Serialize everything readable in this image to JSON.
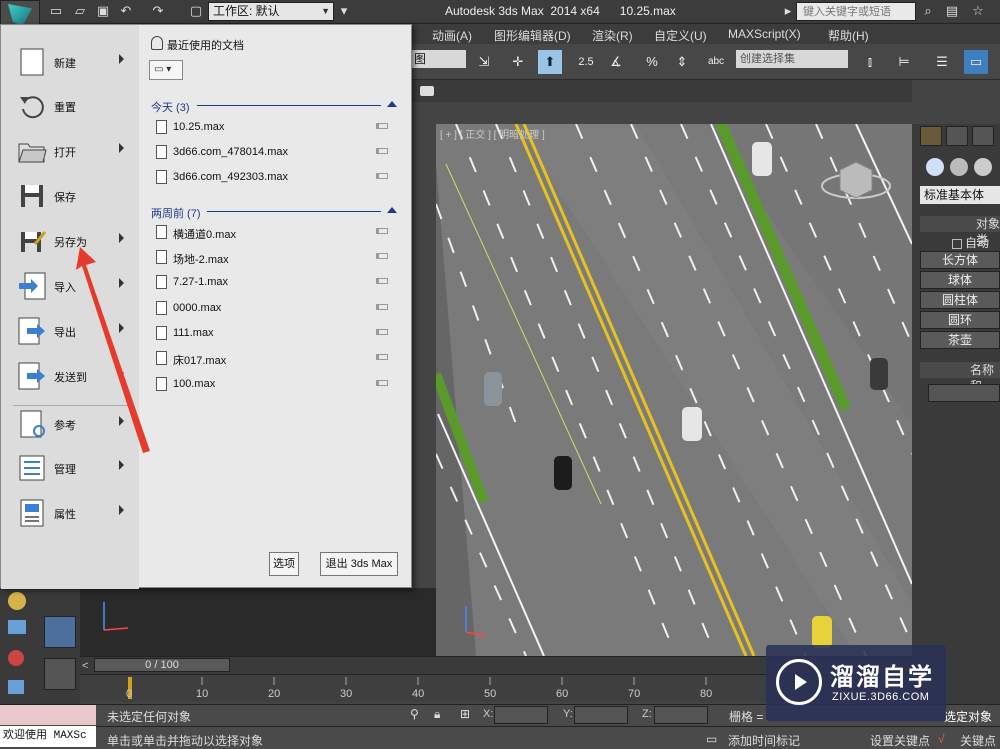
{
  "titlebar": {
    "workspace_label": "工作区: 默认",
    "app_title": "Autodesk 3ds Max  2014 x64      10.25.max",
    "search_placeholder": "键入关键字或短语"
  },
  "menubar": {
    "items": [
      "动画(A)",
      "图形编辑器(D)",
      "渲染(R)",
      "自定义(U)",
      "MAXScript(X)",
      "帮助(H)"
    ]
  },
  "toolbar": {
    "view_select": "图",
    "snap_value": "2.5",
    "selection_set_placeholder": "创建选择集"
  },
  "viewport": {
    "label": "[ + ] [ 正交 ] [ 明暗处理 ]"
  },
  "command_panel": {
    "dropdown": "标准基本体",
    "object_type_header": "对象类",
    "autogrid": "自动栅",
    "buttons": [
      "长方体",
      "球体",
      "圆柱体",
      "圆环",
      "茶壶"
    ],
    "name_header": "名称和"
  },
  "timeline": {
    "slider_text": "0 / 100",
    "ticks": [
      "0",
      "10",
      "20",
      "30",
      "40",
      "50",
      "60",
      "70",
      "80"
    ]
  },
  "status": {
    "maxscript_label": "欢迎使用 MAXSc",
    "selection_text": "未选定任何对象",
    "prompt_text": "单击或单击并拖动以选择对象",
    "x_label": "X:",
    "y_label": "Y:",
    "z_label": "Z:",
    "grid_label": "栅格 =",
    "selected_object": "选定对象",
    "add_time_tag": "添加时间标记",
    "set_key": "设置关键点",
    "key_filter": "关键点"
  },
  "watermark": {
    "title": "溜溜自学",
    "subtitle": "ZIXUE.3D66.COM"
  },
  "app_menu": {
    "commands": [
      {
        "label": "新建",
        "arrow": true
      },
      {
        "label": "重置",
        "arrow": false
      },
      {
        "label": "打开",
        "arrow": true
      },
      {
        "label": "保存",
        "arrow": false
      },
      {
        "label": "另存为",
        "arrow": true
      },
      {
        "label": "导入",
        "arrow": true
      },
      {
        "label": "导出",
        "arrow": true
      },
      {
        "label": "发送到",
        "arrow": true
      },
      {
        "label": "参考",
        "arrow": true
      },
      {
        "label": "管理",
        "arrow": true
      },
      {
        "label": "属性",
        "arrow": true
      }
    ],
    "recent_title": "最近使用的文档",
    "groups": [
      {
        "label": "今天 (3)",
        "files": [
          "10.25.max",
          "3d66.com_478014.max",
          "3d66.com_492303.max"
        ]
      },
      {
        "label": "两周前 (7)",
        "files": [
          "横通道0.max",
          "场地-2.max",
          "7.27-1.max",
          "0000.max",
          "111.max",
          "床017.max",
          "100.max"
        ]
      }
    ],
    "options_button": "选项",
    "exit_button": "退出 3ds Max"
  },
  "colors": {
    "accent_blue": "#1f3a8a",
    "road_yellow": "#e8c21c",
    "hedge_green": "#5a9a2a",
    "annotation_red": "#e53b2c"
  }
}
